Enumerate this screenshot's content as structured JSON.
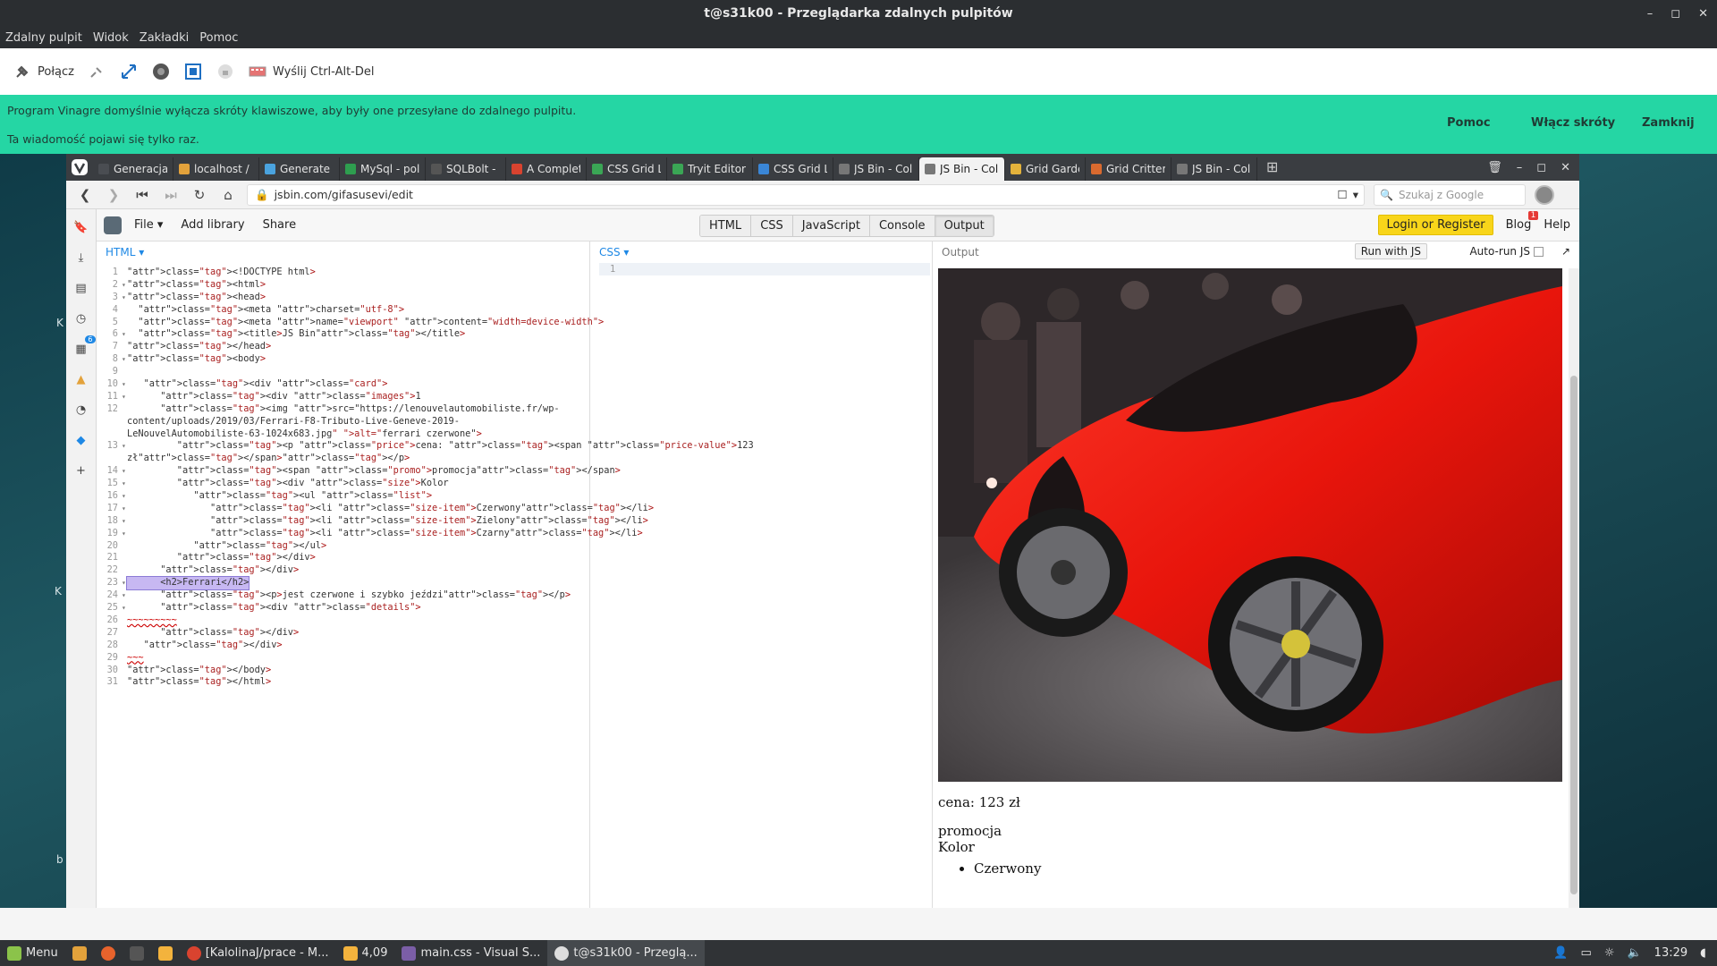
{
  "window": {
    "title": "t@s31k00 - Przeglądarka zdalnych pulpitów",
    "menu": [
      "Zdalny pulpit",
      "Widok",
      "Zakładki",
      "Pomoc"
    ]
  },
  "vinagre_toolbar": {
    "connect_label": "Połącz",
    "ctrl_alt_del_label": "Wyślij Ctrl-Alt-Del"
  },
  "banner": {
    "line1": "Program Vinagre domyślnie wyłącza skróty klawiszowe, aby były one przesyłane do zdalnego pulpitu.",
    "line2": "Ta wiadomość pojawi się tylko raz.",
    "help": "Pomoc",
    "enable": "Włącz skróty",
    "close": "Zamknij"
  },
  "ghost_letters": [
    "K",
    "K",
    "b"
  ],
  "browser": {
    "tabs": [
      {
        "label": "Generacja ko",
        "color": "#4a4d52"
      },
      {
        "label": "localhost / lo",
        "color": "#e3a23b"
      },
      {
        "label": "Generate - C",
        "color": "#4aa3df"
      },
      {
        "label": "MySql - polec",
        "color": "#2e9e4f"
      },
      {
        "label": "SQLBolt - Le",
        "color": "#555"
      },
      {
        "label": "A Complete (",
        "color": "#d9432f"
      },
      {
        "label": "CSS Grid Lay",
        "color": "#3aa655"
      },
      {
        "label": "Tryit Editor v",
        "color": "#3aa655"
      },
      {
        "label": "CSS Grid Lay",
        "color": "#3a86d6"
      },
      {
        "label": "JS Bin - Colla",
        "color": "#777"
      },
      {
        "label": "JS Bin - Collal",
        "color": "#777",
        "active": true
      },
      {
        "label": "Grid Garden",
        "color": "#e3b23b"
      },
      {
        "label": "Grid Critters",
        "color": "#d96a2f"
      },
      {
        "label": "JS Bin - Colla",
        "color": "#777"
      }
    ],
    "url": "jsbin.com/gifasusevi/edit",
    "search_placeholder": "Szukaj z Google",
    "panel_badge": "6"
  },
  "jsbin": {
    "menu": {
      "file": "File ▾",
      "add_library": "Add library",
      "share": "Share"
    },
    "panels": [
      "HTML",
      "CSS",
      "JavaScript",
      "Console",
      "Output"
    ],
    "login": "Login or Register",
    "blog": "Blog",
    "blog_badge": "1",
    "help": "Help",
    "html_label": "HTML ▾",
    "css_label": "CSS ▾",
    "css_line": "1",
    "output_label": "Output",
    "run_label": "Run with JS",
    "autorun_label": "Auto-run JS"
  },
  "code": [
    {
      "n": "1",
      "f": "",
      "t": "<!DOCTYPE html>"
    },
    {
      "n": "2",
      "f": "▾",
      "t": "<html>"
    },
    {
      "n": "3",
      "f": "▾",
      "t": "<head>"
    },
    {
      "n": "4",
      "f": "",
      "t": "  <meta charset=\"utf-8\">"
    },
    {
      "n": "5",
      "f": "",
      "t": "  <meta name=\"viewport\" content=\"width=device-width\">"
    },
    {
      "n": "6",
      "f": "▾",
      "t": "  <title>JS Bin</title>"
    },
    {
      "n": "7",
      "f": "",
      "t": "</head>"
    },
    {
      "n": "8",
      "f": "▾",
      "t": "<body>"
    },
    {
      "n": "9",
      "f": "",
      "t": ""
    },
    {
      "n": "10",
      "f": "▾",
      "t": "   <div class=\"card\">"
    },
    {
      "n": "11",
      "f": "▾",
      "t": "      <div class=\"images\">1"
    },
    {
      "n": "12",
      "f": "",
      "t": "      <img src=\"https://lenouvelautomobiliste.fr/wp-"
    },
    {
      "n": "",
      "f": "",
      "t": "content/uploads/2019/03/Ferrari-F8-Tributo-Live-Geneve-2019-"
    },
    {
      "n": "",
      "f": "",
      "t": "LeNouvelAutomobiliste-63-1024x683.jpg\" alt=\"ferrari czerwone\">"
    },
    {
      "n": "13",
      "f": "▾",
      "t": "         <p class=\"price\">cena: <span class=\"price-value\">123"
    },
    {
      "n": "",
      "f": "",
      "t": "zł</span></p>"
    },
    {
      "n": "14",
      "f": "▾",
      "t": "         <span class=\"promo\">promocja</span>"
    },
    {
      "n": "15",
      "f": "▾",
      "t": "         <div class=\"size\">Kolor"
    },
    {
      "n": "16",
      "f": "▾",
      "t": "            <ul class=\"list\">"
    },
    {
      "n": "17",
      "f": "▾",
      "t": "               <li class=\"size-item\">Czerwony</li>"
    },
    {
      "n": "18",
      "f": "▾",
      "t": "               <li class=\"size-item\">Zielony</li>"
    },
    {
      "n": "19",
      "f": "▾",
      "t": "               <li class=\"size-item\">Czarny</li>"
    },
    {
      "n": "20",
      "f": "",
      "t": "            </ul>"
    },
    {
      "n": "21",
      "f": "",
      "t": "         </div>"
    },
    {
      "n": "22",
      "f": "",
      "t": "      </div>"
    },
    {
      "n": "23",
      "f": "▾",
      "t": "      <h2>Ferrari</h2>",
      "selected": true
    },
    {
      "n": "24",
      "f": "▾",
      "t": "      <p>jest czerwone i szybko jeździ</p>"
    },
    {
      "n": "25",
      "f": "▾",
      "t": "      <div class=\"details\">"
    },
    {
      "n": "26",
      "f": "",
      "t": "~~~~~~~~~",
      "error": true
    },
    {
      "n": "27",
      "f": "",
      "t": "      </div>"
    },
    {
      "n": "28",
      "f": "",
      "t": "   </div>"
    },
    {
      "n": "29",
      "f": "",
      "t": "~~~",
      "error": true
    },
    {
      "n": "30",
      "f": "",
      "t": "</body>"
    },
    {
      "n": "31",
      "f": "",
      "t": "</html>"
    }
  ],
  "output": {
    "image_alt": "ferrari czerwone",
    "price": "cena: 123 zł",
    "promo": "promocja",
    "kolor": "Kolor",
    "list": [
      "Czerwony"
    ]
  },
  "taskbar": {
    "menu": "Menu",
    "items": [
      "[KalolinaJ/prace - M...",
      "4,09",
      "main.css - Visual S...",
      "t@s31k00 - Przeglą..."
    ],
    "clock": "13:29"
  }
}
